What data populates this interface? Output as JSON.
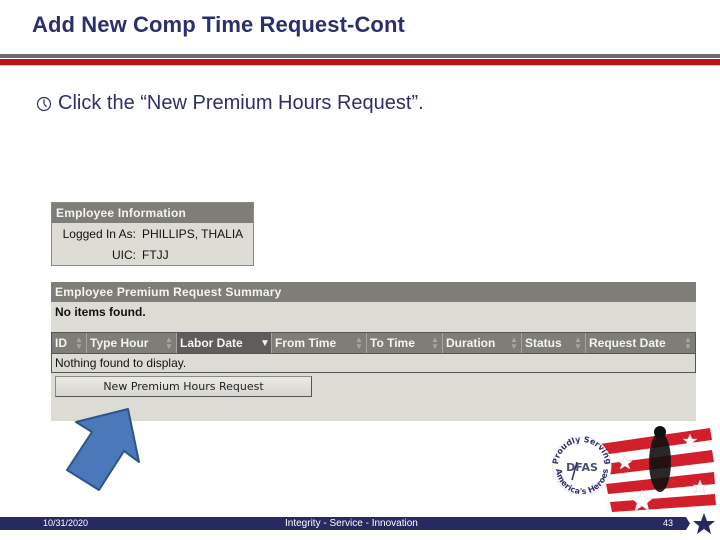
{
  "slide": {
    "title": "Add New Comp Time Request-Cont",
    "bullet_icon": "clock-icon",
    "bullet_text": "Click the “New Premium Hours Request”."
  },
  "employee_info": {
    "header": "Employee Information",
    "rows": [
      {
        "label": "Logged In As:",
        "value": "PHILLIPS, THALIA"
      },
      {
        "label": "UIC:",
        "value": "FTJJ"
      }
    ]
  },
  "summary": {
    "header": "Employee Premium Request Summary",
    "status_text": "No items found.",
    "columns": [
      {
        "label": "ID",
        "sort": "none"
      },
      {
        "label": "Type Hour",
        "sort": "none"
      },
      {
        "label": "Labor Date",
        "sort": "descending"
      },
      {
        "label": "From Time",
        "sort": "none"
      },
      {
        "label": "To Time",
        "sort": "none"
      },
      {
        "label": "Duration",
        "sort": "none"
      },
      {
        "label": "Status",
        "sort": "none"
      },
      {
        "label": "Request Date",
        "sort": "none"
      }
    ],
    "empty_message": "Nothing found to display.",
    "new_button_label": "New Premium Hours Request"
  },
  "annotation": {
    "arrow_color": "#4a78b8",
    "arrow_target": "New Premium Hours Request"
  },
  "logo": {
    "ring_top": "Proudly Serving",
    "ring_bottom": "America's Heroes",
    "center": "DFAS"
  },
  "footer": {
    "date": "10/31/2020",
    "motto": "Integrity - Service - Innovation",
    "page_number": "43"
  },
  "colors": {
    "title": "#2b2f6b",
    "rule_red": "#c0111a",
    "rule_gray": "#6b6b6b",
    "footer_bg": "#272a61",
    "panel_bg": "#dcdbd4",
    "panel_header": "#7e7d78"
  }
}
